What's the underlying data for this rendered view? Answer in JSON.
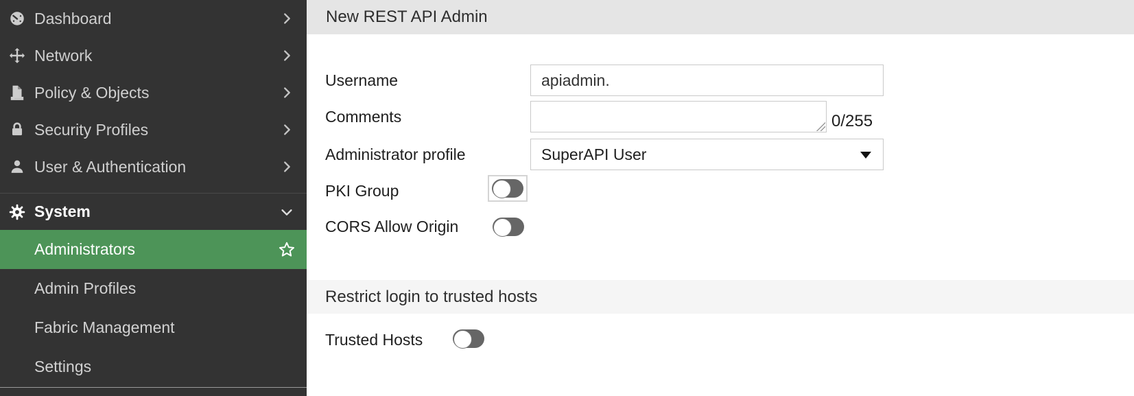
{
  "sidebar": {
    "items": [
      {
        "label": "Dashboard",
        "icon": "gauge-icon",
        "chevron": "right"
      },
      {
        "label": "Network",
        "icon": "move-icon",
        "chevron": "right"
      },
      {
        "label": "Policy & Objects",
        "icon": "document-icon",
        "chevron": "right"
      },
      {
        "label": "Security Profiles",
        "icon": "lock-icon",
        "chevron": "right"
      },
      {
        "label": "User & Authentication",
        "icon": "user-icon",
        "chevron": "right"
      },
      {
        "label": "System",
        "icon": "gear-icon",
        "chevron": "down",
        "expanded": true
      }
    ],
    "sub_items": [
      {
        "label": "Administrators",
        "selected": true,
        "favorite_icon": "star-outline-icon"
      },
      {
        "label": "Admin Profiles"
      },
      {
        "label": "Fabric Management"
      },
      {
        "label": "Settings"
      }
    ]
  },
  "main": {
    "title": "New REST API Admin",
    "form": {
      "username": {
        "label": "Username",
        "value": "apiadmin."
      },
      "comments": {
        "label": "Comments",
        "value": "",
        "counter": "0/255"
      },
      "admin_profile": {
        "label": "Administrator profile",
        "value": "SuperAPI User"
      },
      "pki_group": {
        "label": "PKI Group",
        "state": "off"
      },
      "cors": {
        "label": "CORS Allow Origin",
        "state": "off"
      },
      "trusted_hosts": {
        "label": "Trusted Hosts",
        "state": "off"
      }
    },
    "section": {
      "title": "Restrict login to trusted hosts"
    }
  },
  "colors": {
    "sidebar_background": "#333333",
    "active_item_green": "#4d9458",
    "header_bar": "#e5e5e5",
    "section_bar": "#f5f5f5",
    "toggle_off": "#666666",
    "input_border": "#c9c9c9"
  }
}
